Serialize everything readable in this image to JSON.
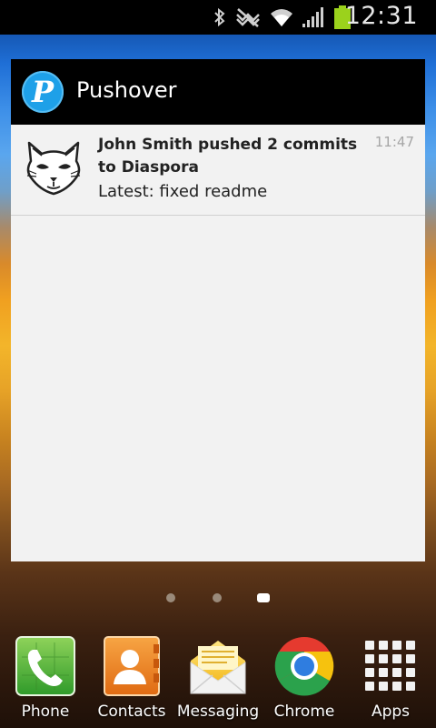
{
  "status_bar": {
    "time": "12:31",
    "icons": [
      "bluetooth-icon",
      "mute-icon",
      "wifi-icon",
      "signal-icon",
      "battery-icon"
    ]
  },
  "widget": {
    "app_name": "Pushover",
    "logo_letter": "P",
    "notification": {
      "title": "John Smith pushed 2 commits to Diaspora",
      "message": "Latest: fixed readme",
      "time": "11:47",
      "icon": "fox-avatar-icon"
    }
  },
  "page_indicator": {
    "count": 3,
    "active": 3
  },
  "dock": [
    {
      "label": "Phone",
      "icon": "phone-icon"
    },
    {
      "label": "Contacts",
      "icon": "contacts-icon"
    },
    {
      "label": "Messaging",
      "icon": "messaging-icon"
    },
    {
      "label": "Chrome",
      "icon": "chrome-icon"
    },
    {
      "label": "Apps",
      "icon": "apps-grid-icon"
    }
  ]
}
